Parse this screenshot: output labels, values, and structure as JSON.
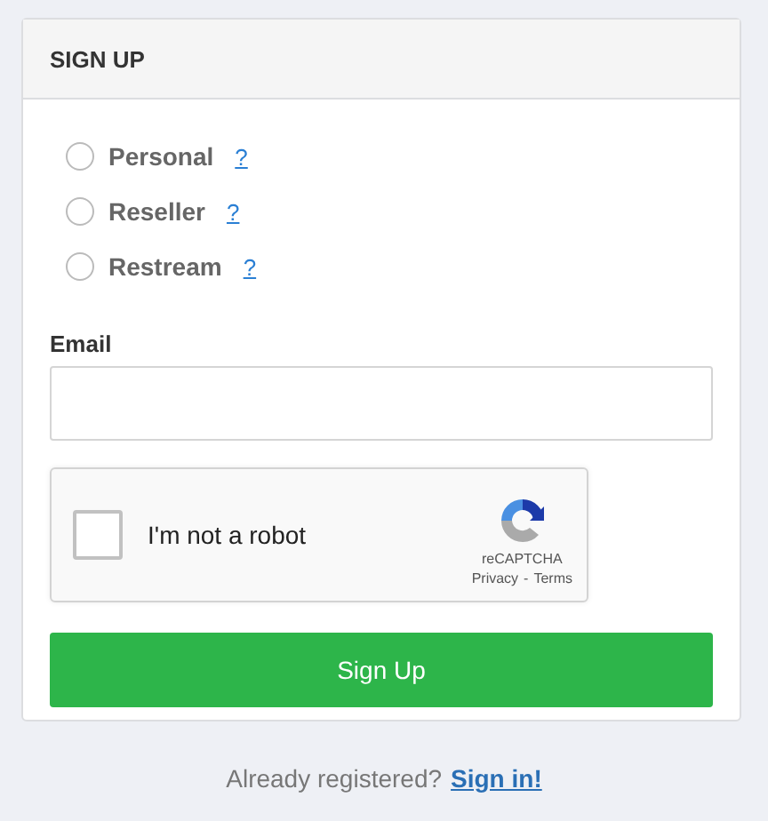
{
  "card": {
    "title": "SIGN UP"
  },
  "account_types": [
    {
      "label": "Personal",
      "help": "?",
      "selected": false
    },
    {
      "label": "Reseller",
      "help": "?",
      "selected": false
    },
    {
      "label": "Restream",
      "help": "?",
      "selected": false
    }
  ],
  "email": {
    "label": "Email"
  },
  "captcha": {
    "label": "I'm not a robot",
    "checked": false,
    "brand": "reCAPTCHA",
    "privacy": "Privacy",
    "separator": "-",
    "terms": "Terms"
  },
  "submit": {
    "label": "Sign Up"
  },
  "footer": {
    "text": "Already registered?",
    "link": "Sign in!"
  }
}
